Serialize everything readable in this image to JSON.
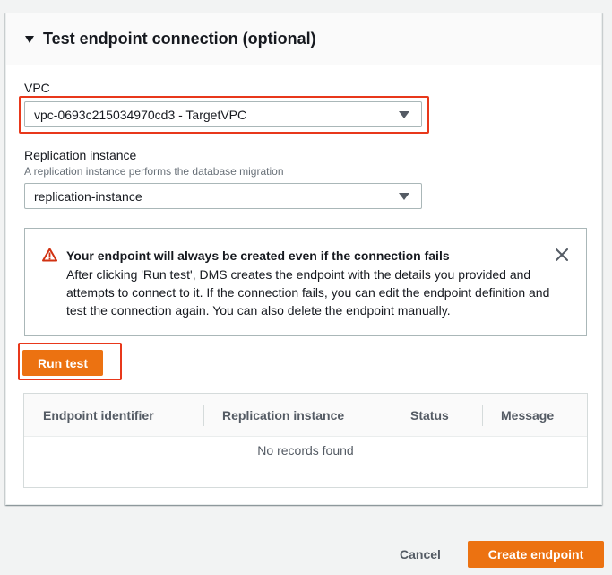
{
  "section": {
    "title": "Test endpoint connection (optional)"
  },
  "vpc": {
    "label": "VPC",
    "selected": "vpc-0693c215034970cd3 - TargetVPC"
  },
  "replication": {
    "label": "Replication instance",
    "description": "A replication instance performs the database migration",
    "selected": "replication-instance"
  },
  "alert": {
    "title": "Your endpoint will always be created even if the connection fails",
    "body": "After clicking 'Run test', DMS creates the endpoint with the details you provided and attempts to connect to it. If the connection fails, you can edit the endpoint definition and test the connection again. You can also delete the endpoint manually.",
    "icon": "warning-icon",
    "color": "#d13212"
  },
  "run_test": {
    "label": "Run test"
  },
  "table": {
    "columns": [
      "Endpoint identifier",
      "Replication instance",
      "Status",
      "Message"
    ],
    "empty_text": "No records found"
  },
  "footer": {
    "cancel_label": "Cancel",
    "create_label": "Create endpoint"
  },
  "colors": {
    "accent": "#ec7211",
    "highlight": "#e8381b"
  }
}
